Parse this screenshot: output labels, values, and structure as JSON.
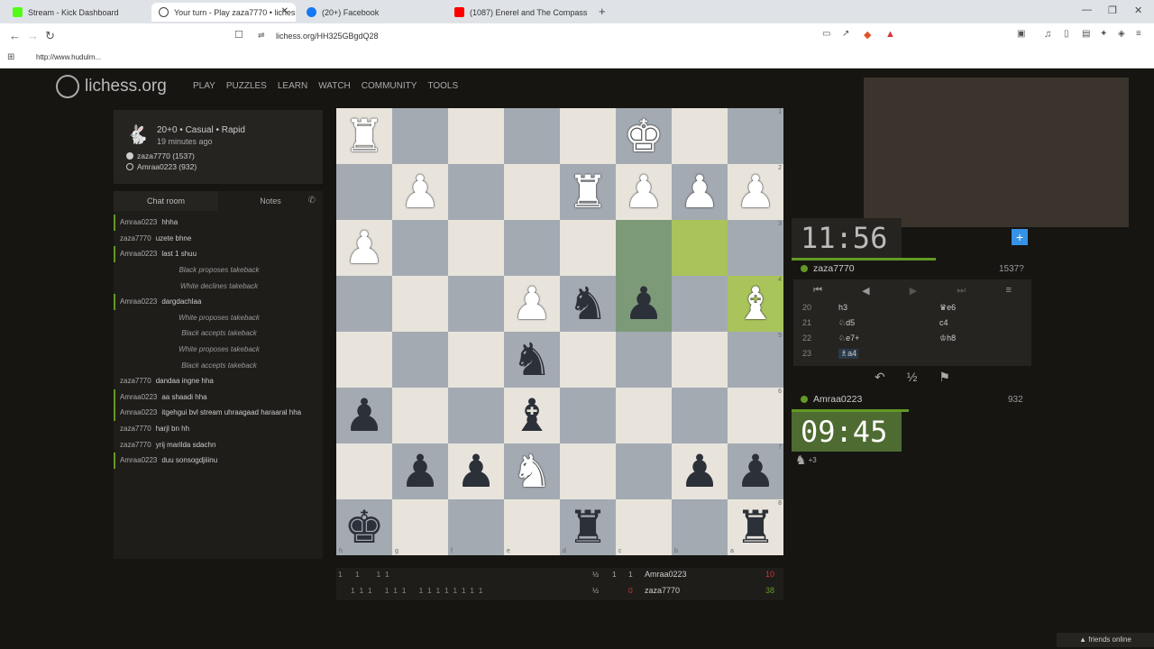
{
  "browser": {
    "tabs": [
      {
        "title": "Stream - Kick Dashboard",
        "favicon_color": "#53fc18"
      },
      {
        "title": "Your turn - Play zaza7770 • lichess.org",
        "favicon_color": "#444444"
      },
      {
        "title": "(20+) Facebook",
        "favicon_color": "#1877f2"
      },
      {
        "title": "(1087) Enerel and The Compass",
        "favicon_color": "#ff0000"
      }
    ],
    "url": "lichess.org/HH325GBgdQ28",
    "bookmark": "http://www.hudulm..."
  },
  "site": {
    "logo_text": "lichess.org",
    "nav": [
      "PLAY",
      "PUZZLES",
      "LEARN",
      "WATCH",
      "COMMUNITY",
      "TOOLS"
    ]
  },
  "game": {
    "mode": "20+0 • Casual • Rapid",
    "started": "19 minutes ago",
    "white_player": "zaza7770 (1537)",
    "black_player": "Amraa0223 (932)"
  },
  "chat": {
    "tabs": [
      "Chat room",
      "Notes"
    ],
    "messages": [
      {
        "user": "Amraa0223",
        "text": "hhha",
        "mark": true
      },
      {
        "user": "zaza7770",
        "text": "uzete bhne",
        "mark": false
      },
      {
        "user": "Amraa0223",
        "text": "last 1 shuu",
        "mark": true
      },
      {
        "user": "",
        "text": "Black proposes takeback",
        "mark": false
      },
      {
        "user": "",
        "text": "White declines takeback",
        "mark": false
      },
      {
        "user": "Amraa0223",
        "text": "dargdachlaa",
        "mark": true
      },
      {
        "user": "",
        "text": "White proposes takeback",
        "mark": false
      },
      {
        "user": "",
        "text": "Black accepts takeback",
        "mark": false
      },
      {
        "user": "",
        "text": "White proposes takeback",
        "mark": false
      },
      {
        "user": "",
        "text": "Black accepts takeback",
        "mark": false
      },
      {
        "user": "zaza7770",
        "text": "dandaa ingne hha",
        "mark": false
      },
      {
        "user": "Amraa0223",
        "text": "aa shaadi hha",
        "mark": true
      },
      {
        "user": "Amraa0223",
        "text": "itgehgui bvl stream uhraagaad haraaral hha",
        "mark": true
      },
      {
        "user": "zaza7770",
        "text": "harjl bn hh",
        "mark": false
      },
      {
        "user": "zaza7770",
        "text": "yrij marilda sdachn",
        "mark": false
      },
      {
        "user": "Amraa0223",
        "text": "duu sonsogdjiiinu",
        "mark": true
      }
    ]
  },
  "board": {
    "squares": [
      [
        "wR",
        "",
        "",
        "",
        "",
        "wK",
        "",
        ""
      ],
      [
        "",
        "wP",
        "",
        "",
        "wR",
        "wP",
        "wP",
        "wP"
      ],
      [
        "wP",
        "",
        "",
        "",
        "",
        "",
        "",
        ""
      ],
      [
        "",
        "",
        "",
        "wP",
        "bN",
        "bP",
        "",
        "wB"
      ],
      [
        "",
        "",
        "",
        "bN",
        "",
        "",
        "",
        ""
      ],
      [
        "bP",
        "",
        "",
        "bB",
        "",
        "",
        "",
        ""
      ],
      [
        "",
        "bP",
        "bP",
        "wN",
        "",
        "",
        "bP",
        "bP"
      ],
      [
        "bK",
        "",
        "",
        "",
        "bR",
        "",
        "",
        "bR"
      ]
    ],
    "highlight_dark": [
      [
        2,
        5
      ],
      [
        3,
        5
      ]
    ],
    "highlight_light": [
      [
        2,
        6
      ],
      [
        3,
        7
      ]
    ],
    "rank_labels": [
      "1",
      "2",
      "3",
      "4",
      "5",
      "6",
      "7",
      "8"
    ],
    "file_labels": [
      "h",
      "g",
      "f",
      "e",
      "d",
      "c",
      "b",
      "a"
    ]
  },
  "clocks": {
    "top": {
      "time": "11:56",
      "player": "zaza7770",
      "rating": "1537?"
    },
    "bottom": {
      "time": "09:45",
      "player": "Amraa0223",
      "rating": "932"
    }
  },
  "moves": [
    {
      "n": "20",
      "w": "h3",
      "b": "♛e6"
    },
    {
      "n": "21",
      "w": "♘d5",
      "b": "c4"
    },
    {
      "n": "22",
      "w": "♘e7+",
      "b": "♔h8"
    },
    {
      "n": "23",
      "w": "♗a4",
      "b": ""
    }
  ],
  "material": "+3",
  "crosstable": {
    "row1": {
      "marks": "1      1        1  1",
      "half": "½",
      "one": "1",
      "one2": "1",
      "name": "Amraa0223",
      "score": "10"
    },
    "row2": {
      "marks": "1  1  1      1  1  1      1  1  1  1  1  1  1  1",
      "half": "½",
      "zero": "0",
      "name": "zaza7770",
      "score": "38"
    }
  },
  "friends": "▲ friends online"
}
